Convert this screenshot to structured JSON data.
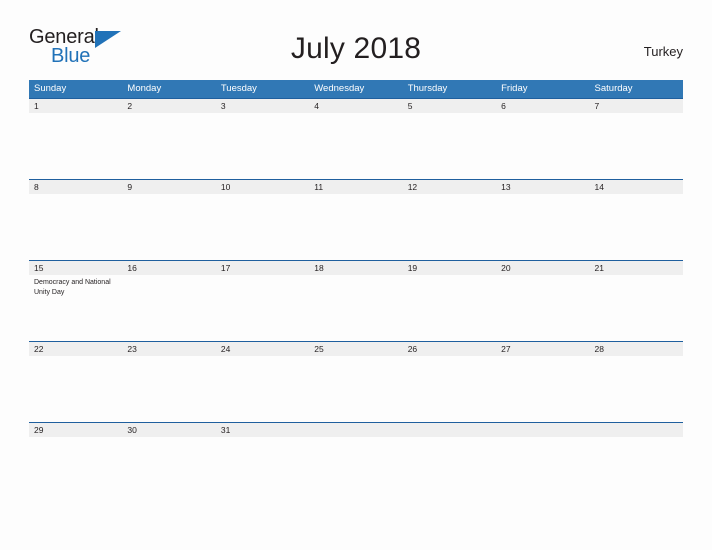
{
  "brand": {
    "name_part1": "General",
    "name_part2": "Blue",
    "triangle_icon": "triangle-icon",
    "color_dark": "#231f20",
    "color_blue": "#2172b8"
  },
  "header": {
    "title": "July 2018",
    "region": "Turkey"
  },
  "calendar": {
    "header_color": "#3178b5",
    "date_band_color": "#efefef",
    "row_line_color": "#1f5f9e",
    "weekdays": [
      "Sunday",
      "Monday",
      "Tuesday",
      "Wednesday",
      "Thursday",
      "Friday",
      "Saturday"
    ],
    "weeks": [
      {
        "days": [
          {
            "date": "1",
            "events": []
          },
          {
            "date": "2",
            "events": []
          },
          {
            "date": "3",
            "events": []
          },
          {
            "date": "4",
            "events": []
          },
          {
            "date": "5",
            "events": []
          },
          {
            "date": "6",
            "events": []
          },
          {
            "date": "7",
            "events": []
          }
        ]
      },
      {
        "days": [
          {
            "date": "8",
            "events": []
          },
          {
            "date": "9",
            "events": []
          },
          {
            "date": "10",
            "events": []
          },
          {
            "date": "11",
            "events": []
          },
          {
            "date": "12",
            "events": []
          },
          {
            "date": "13",
            "events": []
          },
          {
            "date": "14",
            "events": []
          }
        ]
      },
      {
        "days": [
          {
            "date": "15",
            "events": [
              "Democracy and National Unity Day"
            ]
          },
          {
            "date": "16",
            "events": []
          },
          {
            "date": "17",
            "events": []
          },
          {
            "date": "18",
            "events": []
          },
          {
            "date": "19",
            "events": []
          },
          {
            "date": "20",
            "events": []
          },
          {
            "date": "21",
            "events": []
          }
        ]
      },
      {
        "days": [
          {
            "date": "22",
            "events": []
          },
          {
            "date": "23",
            "events": []
          },
          {
            "date": "24",
            "events": []
          },
          {
            "date": "25",
            "events": []
          },
          {
            "date": "26",
            "events": []
          },
          {
            "date": "27",
            "events": []
          },
          {
            "date": "28",
            "events": []
          }
        ]
      },
      {
        "days": [
          {
            "date": "29",
            "events": []
          },
          {
            "date": "30",
            "events": []
          },
          {
            "date": "31",
            "events": []
          },
          {
            "date": "",
            "events": []
          },
          {
            "date": "",
            "events": []
          },
          {
            "date": "",
            "events": []
          },
          {
            "date": "",
            "events": []
          }
        ]
      }
    ]
  }
}
